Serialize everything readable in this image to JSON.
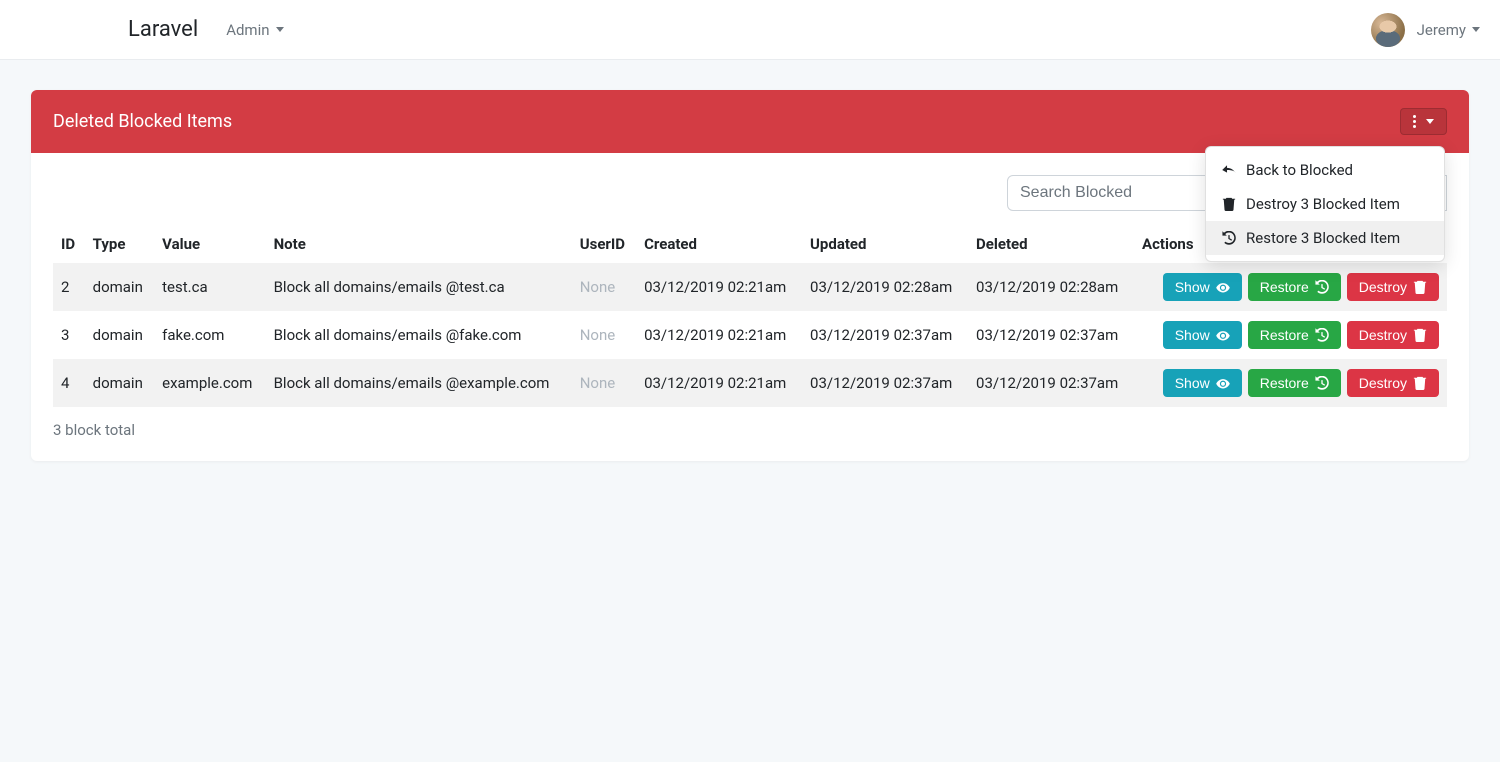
{
  "navbar": {
    "brand": "Laravel",
    "admin_label": "Admin",
    "user_name": "Jeremy"
  },
  "card": {
    "title": "Deleted Blocked Items"
  },
  "dropdown": {
    "back": "Back to Blocked",
    "destroy": "Destroy 3 Blocked Item",
    "restore": "Restore 3 Blocked Item"
  },
  "search": {
    "placeholder": "Search Blocked",
    "value": ""
  },
  "columns": {
    "id": "ID",
    "type": "Type",
    "value": "Value",
    "note": "Note",
    "userid": "UserID",
    "created": "Created",
    "updated": "Updated",
    "deleted": "Deleted",
    "actions": "Actions"
  },
  "buttons": {
    "show": "Show",
    "restore": "Restore",
    "destroy": "Destroy"
  },
  "rows": [
    {
      "id": "2",
      "type": "domain",
      "value": "test.ca",
      "note": "Block all domains/emails @test.ca",
      "userid": "None",
      "created": "03/12/2019 02:21am",
      "updated": "03/12/2019 02:28am",
      "deleted": "03/12/2019 02:28am"
    },
    {
      "id": "3",
      "type": "domain",
      "value": "fake.com",
      "note": "Block all domains/emails @fake.com",
      "userid": "None",
      "created": "03/12/2019 02:21am",
      "updated": "03/12/2019 02:37am",
      "deleted": "03/12/2019 02:37am"
    },
    {
      "id": "4",
      "type": "domain",
      "value": "example.com",
      "note": "Block all domains/emails @example.com",
      "userid": "None",
      "created": "03/12/2019 02:21am",
      "updated": "03/12/2019 02:37am",
      "deleted": "03/12/2019 02:37am"
    }
  ],
  "summary": "3 block total"
}
